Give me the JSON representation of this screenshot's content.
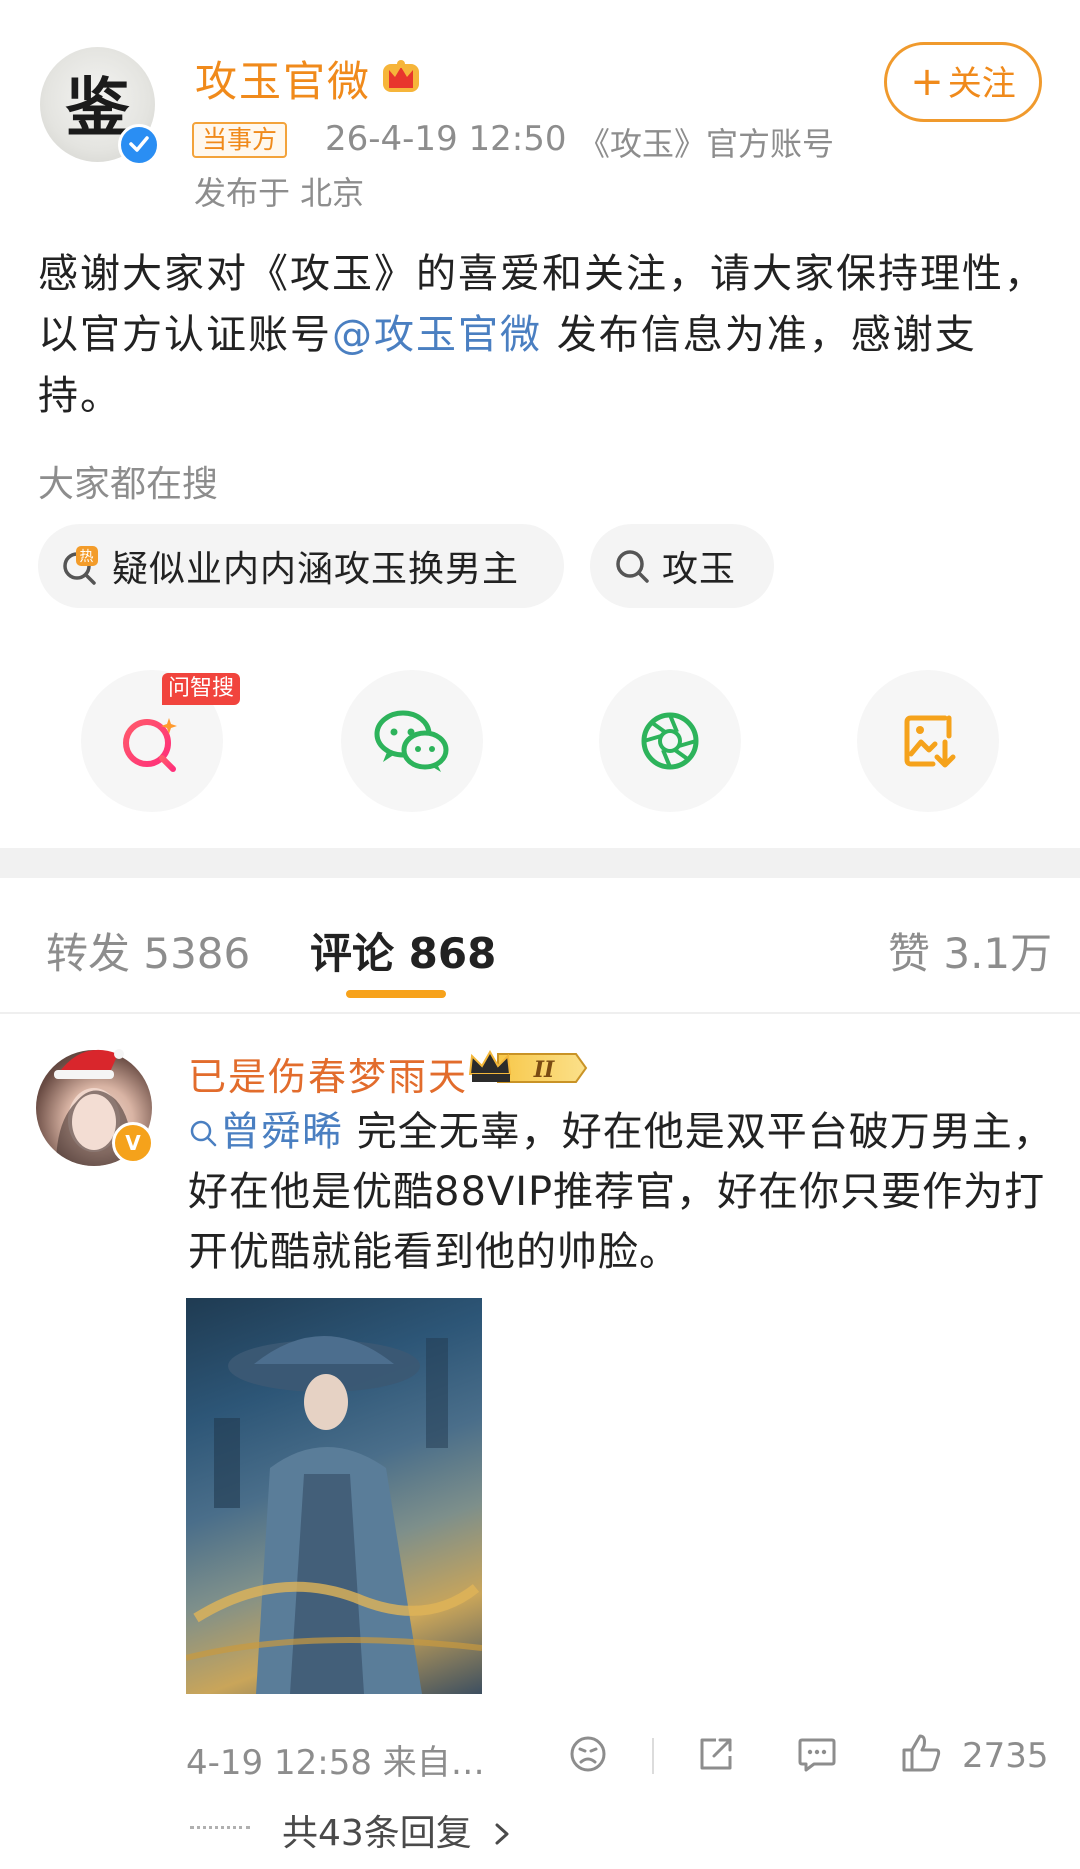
{
  "post": {
    "author": "攻玉官微",
    "avatar_glyph": "鉴",
    "party_badge": "当事方",
    "time": "26-4-19 12:50",
    "account_desc": "《攻玉》官方账号",
    "location": "发布于 北京",
    "follow_label": "关注",
    "body_part1": "感谢大家对《攻玉》的喜爱和关注，请大家保持理性，以官方认证账号",
    "body_mention": "@攻玉官微",
    "body_part2": " 发布信息为准，感谢支持。"
  },
  "search": {
    "label": "大家都在搜",
    "chips": [
      "疑似业内内涵攻玉换男主",
      "攻玉"
    ]
  },
  "share": {
    "ai_badge": "问智搜",
    "icons": [
      "ai-search-icon",
      "wechat-icon",
      "moments-icon",
      "save-image-icon"
    ]
  },
  "tabs": {
    "repost": "转发 5386",
    "comments": "评论 868",
    "likes": "赞 3.1万"
  },
  "comment": {
    "author": "已是伤春梦雨天",
    "vip_level": "II",
    "mention": "曾舜晞",
    "text": " 完全无辜，好在他是双平台破万男主，好在他是优酷88VIP推荐官，好在你只要作为打开优酷就能看到他的帅脸。",
    "time": "4-19 12:58  来自…",
    "likes": "2735",
    "replies": "共43条回复"
  },
  "colors": {
    "accent": "#f08a1b",
    "link": "#4a7fc1",
    "muted": "#8d8d8d"
  }
}
